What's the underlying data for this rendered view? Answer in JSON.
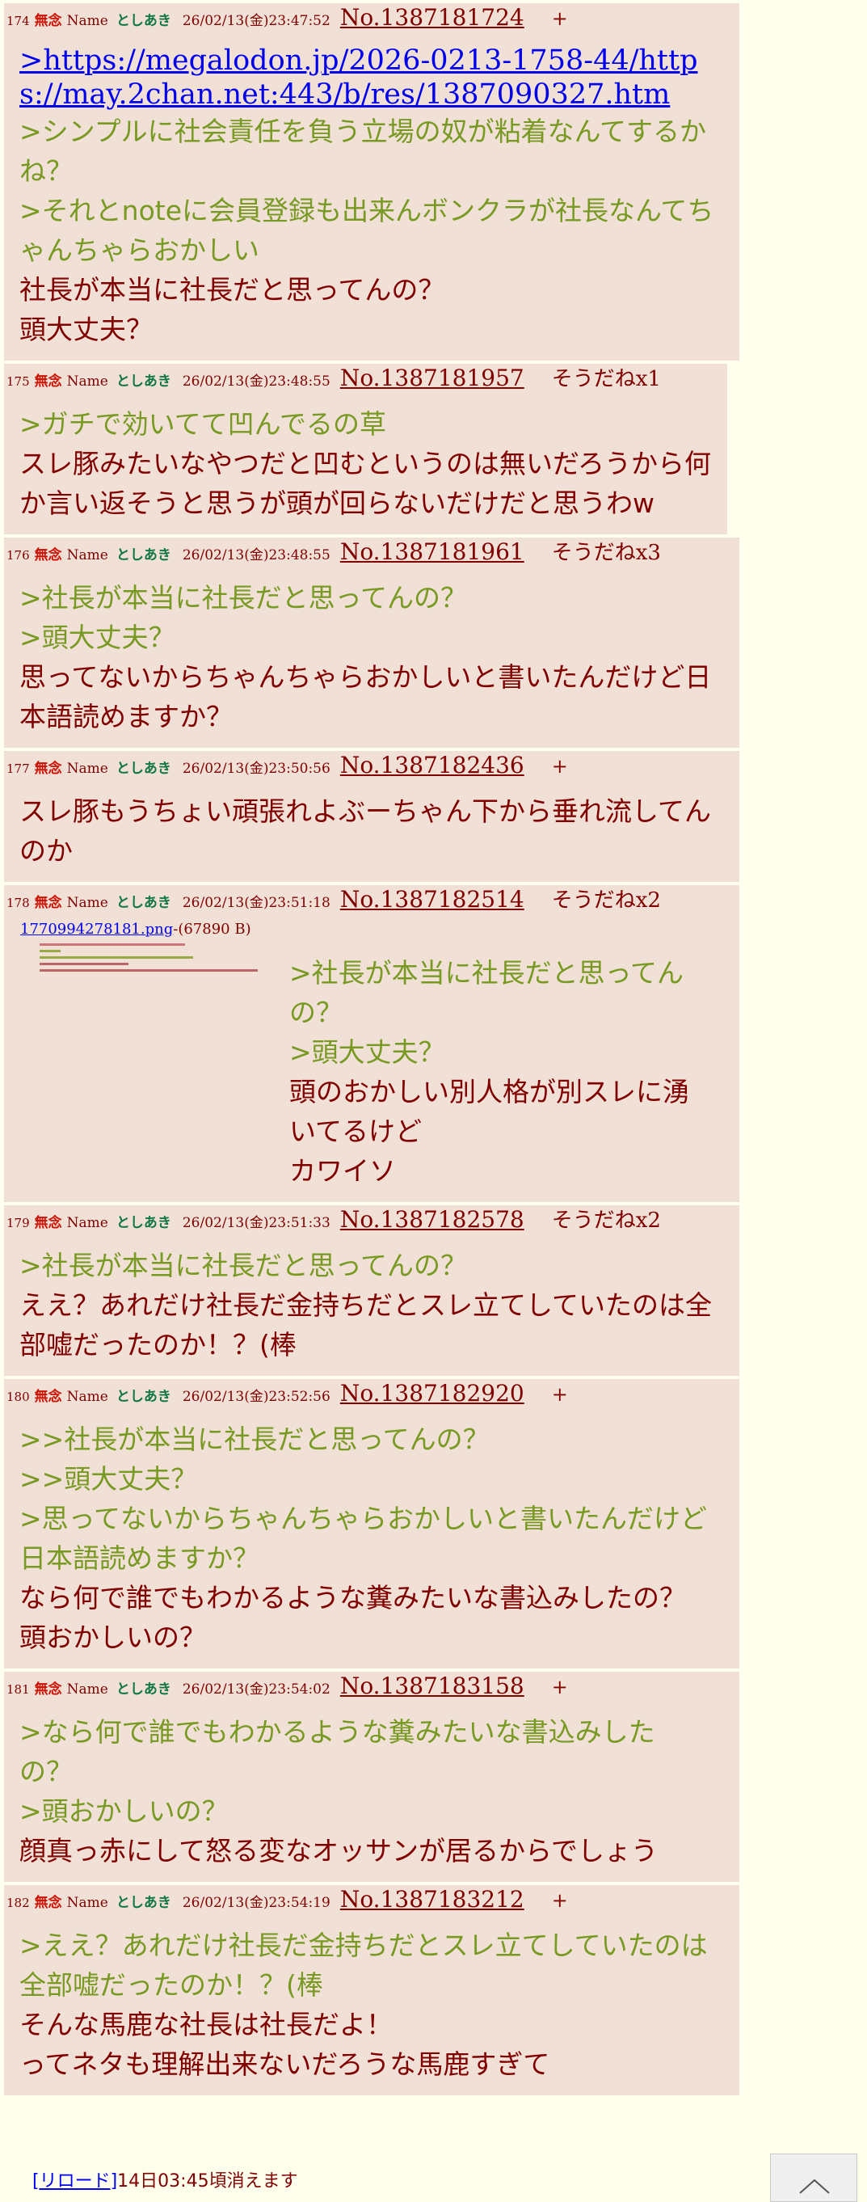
{
  "posts": [
    {
      "num": "174",
      "subject": "無念",
      "name_label": "Name",
      "name": "としあき",
      "date": "26/02/13(金)23:47:52",
      "no": "No.1387181724",
      "sodane": "+",
      "link": ">https://megalodon.jp/2026-0213-1758-44/https://may.2chan.net:443/b/res/1387090327.htm",
      "lines": [
        {
          "q": true,
          "text": ">シンプルに社会責任を負う立場の奴が粘着なんてするかね？"
        },
        {
          "q": true,
          "text": ">それとnoteに会員登録も出来んボンクラが社長なんてちゃんちゃらおかしい"
        },
        {
          "q": false,
          "text": "社長が本当に社長だと思ってんの？"
        },
        {
          "q": false,
          "text": "頭大丈夫？"
        }
      ]
    },
    {
      "num": "175",
      "subject": "無念",
      "name_label": "Name",
      "name": "としあき",
      "date": "26/02/13(金)23:48:55",
      "no": "No.1387181957",
      "sodane": "そうだねx1",
      "lines": [
        {
          "q": true,
          "text": ">ガチで効いてて凹んでるの草"
        },
        {
          "q": false,
          "text": "スレ豚みたいなやつだと凹むというのは無いだろうから何か言い返そうと思うが頭が回らないだけだと思うわw"
        }
      ]
    },
    {
      "num": "176",
      "subject": "無念",
      "name_label": "Name",
      "name": "としあき",
      "date": "26/02/13(金)23:48:55",
      "no": "No.1387181961",
      "sodane": "そうだねx3",
      "lines": [
        {
          "q": true,
          "text": ">社長が本当に社長だと思ってんの？"
        },
        {
          "q": true,
          "text": ">頭大丈夫？"
        },
        {
          "q": false,
          "text": "思ってないからちゃんちゃらおかしいと書いたんだけど日本語読めますか？"
        }
      ]
    },
    {
      "num": "177",
      "subject": "無念",
      "name_label": "Name",
      "name": "としあき",
      "date": "26/02/13(金)23:50:56",
      "no": "No.1387182436",
      "sodane": "+",
      "lines": [
        {
          "q": false,
          "text": "スレ豚もうちょい頑張れよぶーちゃん下から垂れ流してんのか"
        }
      ]
    },
    {
      "num": "178",
      "subject": "無念",
      "name_label": "Name",
      "name": "としあき",
      "date": "26/02/13(金)23:51:18",
      "no": "No.1387182514",
      "sodane": "そうだねx2",
      "file_name": "1770994278181.png",
      "file_size": "-(67890 B)",
      "lines": [
        {
          "q": true,
          "text": ">社長が本当に社長だと思ってんの？"
        },
        {
          "q": true,
          "text": ">頭大丈夫？"
        },
        {
          "q": false,
          "text": "頭のおかしい別人格が別スレに湧いてるけど"
        },
        {
          "q": false,
          "text": "カワイソ"
        }
      ]
    },
    {
      "num": "179",
      "subject": "無念",
      "name_label": "Name",
      "name": "としあき",
      "date": "26/02/13(金)23:51:33",
      "no": "No.1387182578",
      "sodane": "そうだねx2",
      "lines": [
        {
          "q": true,
          "text": ">社長が本当に社長だと思ってんの？"
        },
        {
          "q": false,
          "text": "ええ？あれだけ社長だ金持ちだとスレ立てしていたのは全部嘘だったのか！？(棒"
        }
      ]
    },
    {
      "num": "180",
      "subject": "無念",
      "name_label": "Name",
      "name": "としあき",
      "date": "26/02/13(金)23:52:56",
      "no": "No.1387182920",
      "sodane": "+",
      "lines": [
        {
          "q": true,
          "text": ">>社長が本当に社長だと思ってんの？"
        },
        {
          "q": true,
          "text": ">>頭大丈夫？"
        },
        {
          "q": true,
          "text": ">思ってないからちゃんちゃらおかしいと書いたんだけど日本語読めますか？"
        },
        {
          "q": false,
          "text": "なら何で誰でもわかるような糞みたいな書込みしたの？"
        },
        {
          "q": false,
          "text": "頭おかしいの？"
        }
      ]
    },
    {
      "num": "181",
      "subject": "無念",
      "name_label": "Name",
      "name": "としあき",
      "date": "26/02/13(金)23:54:02",
      "no": "No.1387183158",
      "sodane": "+",
      "lines": [
        {
          "q": true,
          "text": ">なら何で誰でもわかるような糞みたいな書込みしたの？"
        },
        {
          "q": true,
          "text": ">頭おかしいの？"
        },
        {
          "q": false,
          "text": "顔真っ赤にして怒る変なオッサンが居るからでしょう"
        }
      ]
    },
    {
      "num": "182",
      "subject": "無念",
      "name_label": "Name",
      "name": "としあき",
      "date": "26/02/13(金)23:54:19",
      "no": "No.1387183212",
      "sodane": "+",
      "lines": [
        {
          "q": true,
          "text": ">ええ？あれだけ社長だ金持ちだとスレ立てしていたのは全部嘘だったのか！？(棒"
        },
        {
          "q": false,
          "text": "そんな馬鹿な社長は社長だよ！"
        },
        {
          "q": false,
          "text": "ってネタも理解出来ないだろうな馬鹿すぎて"
        }
      ]
    }
  ],
  "footer": {
    "reload_label": "[リロード]",
    "expire_text": "14日03:45頃消えます"
  },
  "scroll_top": {
    "icon": "chevron-up-icon"
  },
  "colors": {
    "background": "#FFFFEE",
    "post_bg": "#F0E0D6",
    "text": "#800000",
    "quote": "#789922",
    "name": "#117743",
    "subject": "#CC1105",
    "link": "#0000EE"
  }
}
